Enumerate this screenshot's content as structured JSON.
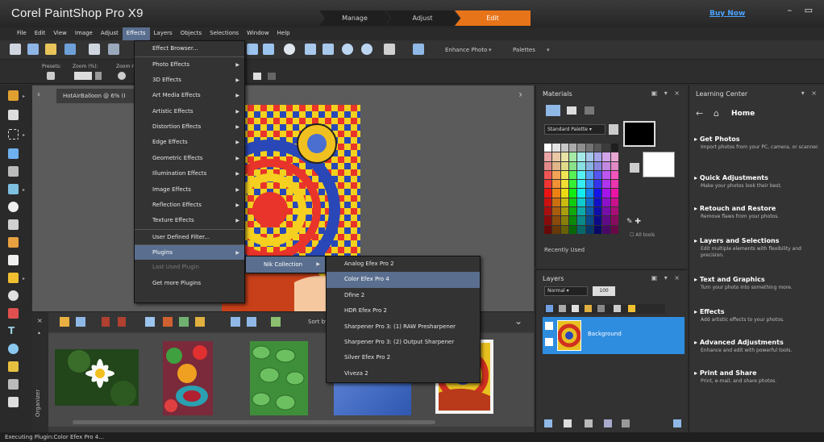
{
  "app": {
    "title": "Corel PaintShop Pro X9",
    "workspaces": [
      "Manage",
      "Adjust",
      "Edit"
    ],
    "buy_now": "Buy Now",
    "window_controls": "– ▭"
  },
  "menubar": [
    "File",
    "Edit",
    "View",
    "Image",
    "Adjust",
    "Effects",
    "Layers",
    "Objects",
    "Selections",
    "Window",
    "Help"
  ],
  "toolbar": {
    "enhance_photo": "Enhance Photo",
    "palettes": "Palettes"
  },
  "options": {
    "presets": "Presets:",
    "zoom_pct": "Zoom (%):",
    "zoom_more": "Zoom m"
  },
  "document": {
    "tab": "HotAirBalloon @ 6% (I"
  },
  "effects_menu": [
    {
      "label": "Effect Browser...",
      "arrow": ""
    },
    {
      "label": "Photo Effects",
      "arrow": "▶"
    },
    {
      "label": "3D Effects",
      "arrow": "▶"
    },
    {
      "label": "Art Media Effects",
      "arrow": "▶"
    },
    {
      "label": "Artistic Effects",
      "arrow": "▶"
    },
    {
      "label": "Distortion Effects",
      "arrow": "▶"
    },
    {
      "label": "Edge Effects",
      "arrow": "▶"
    },
    {
      "label": "Geometric Effects",
      "arrow": "▶"
    },
    {
      "label": "Illumination Effects",
      "arrow": "▶"
    },
    {
      "label": "Image Effects",
      "arrow": "▶"
    },
    {
      "label": "Reflection Effects",
      "arrow": "▶"
    },
    {
      "label": "Texture Effects",
      "arrow": "▶"
    },
    {
      "label": "User Defined Filter...",
      "arrow": ""
    },
    {
      "label": "Plugins",
      "arrow": "▶"
    },
    {
      "label": "Last Used Plugin",
      "arrow": ""
    },
    {
      "label": "Get more Plugins",
      "arrow": ""
    }
  ],
  "plugins_menu": [
    "Nik Collection"
  ],
  "nik_menu": [
    "Analog Efex Pro 2",
    "Color Efex Pro 4",
    "Dfine 2",
    "HDR Efex Pro 2",
    "Sharpener Pro 3: (1) RAW Presharpener",
    "Sharpener Pro 3: (2) Output Sharpener",
    "Silver Efex Pro 2",
    "Viveza 2"
  ],
  "materials": {
    "title": "Materials",
    "palette": "Standard Palette",
    "recently_used": "Recently Used",
    "all_tools": "All tools"
  },
  "layers": {
    "title": "Layers",
    "blend_mode": "Normal",
    "opacity": "100",
    "layer_name": "Background"
  },
  "learning_center": {
    "title": "Learning Center",
    "home": "Home",
    "items": [
      {
        "head": "Get Photos",
        "desc": "Import photos from your PC, camera, or scanner."
      },
      {
        "head": "Quick Adjustments",
        "desc": "Make your photos look their best."
      },
      {
        "head": "Retouch and Restore",
        "desc": "Remove flaws from your photos."
      },
      {
        "head": "Layers and Selections",
        "desc": "Edit multiple elements with flexibility and precision."
      },
      {
        "head": "Text and Graphics",
        "desc": "Turn your photo into something more."
      },
      {
        "head": "Effects",
        "desc": "Add artistic effects to your photos."
      },
      {
        "head": "Advanced Adjustments",
        "desc": "Enhance and edit with powerful tools."
      },
      {
        "head": "Print and Share",
        "desc": "Print, e-mail, and share photos."
      }
    ]
  },
  "organizer": {
    "label": "Organizer",
    "sort_by": "Sort by:"
  },
  "status": "Executing Plugin:Color Efex Pro 4..."
}
